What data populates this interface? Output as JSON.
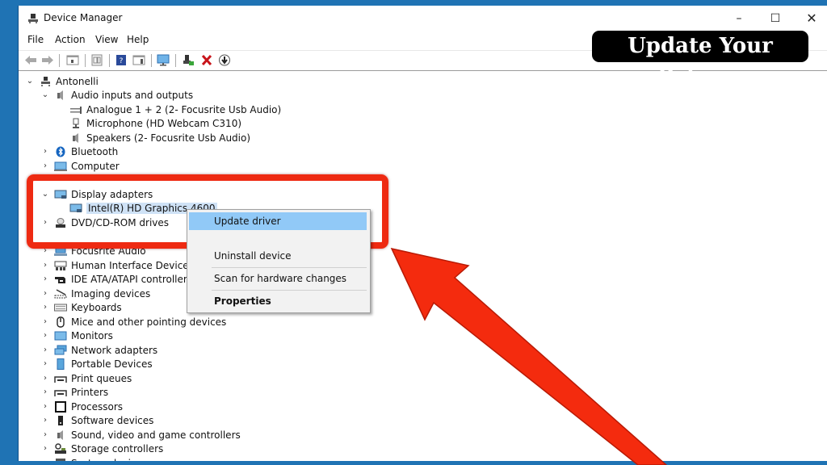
{
  "window": {
    "title": "Device Manager",
    "controls": {
      "minimize": "–",
      "maximize": "☐",
      "close": "✕"
    }
  },
  "menu": [
    "File",
    "Action",
    "View",
    "Help"
  ],
  "toolbar": {
    "icons": [
      "back-arrow-icon",
      "forward-arrow-icon",
      "show-hide-console-tree-icon",
      "properties-icon",
      "help-icon",
      "action-pane-icon",
      "scan-hardware-icon",
      "enable-device-icon",
      "uninstall-device-icon",
      "update-driver-icon"
    ]
  },
  "banner": {
    "text": "Update Your Drivers"
  },
  "tree": {
    "root": "Antonelli",
    "items": [
      {
        "label": "Audio inputs and outputs",
        "expanded": true,
        "children": [
          "Analogue 1 + 2 (2- Focusrite Usb Audio)",
          "Microphone (HD Webcam C310)",
          "Speakers (2- Focusrite Usb Audio)"
        ]
      },
      {
        "label": "Bluetooth",
        "expanded": false
      },
      {
        "label": "Computer",
        "expanded": false
      },
      {
        "label": "Display adapters",
        "expanded": true,
        "children": [
          "Intel(R) HD Graphics 4600"
        ]
      },
      {
        "label": "DVD/CD-ROM drives",
        "expanded": false
      },
      {
        "label": "Focusrite Audio",
        "expanded": false
      },
      {
        "label": "Human Interface Devices",
        "expanded": false
      },
      {
        "label": "IDE ATA/ATAPI controllers",
        "expanded": false
      },
      {
        "label": "Imaging devices",
        "expanded": false
      },
      {
        "label": "Keyboards",
        "expanded": false
      },
      {
        "label": "Mice and other pointing devices",
        "expanded": false
      },
      {
        "label": "Monitors",
        "expanded": false
      },
      {
        "label": "Network adapters",
        "expanded": false
      },
      {
        "label": "Portable Devices",
        "expanded": false
      },
      {
        "label": "Print queues",
        "expanded": false
      },
      {
        "label": "Printers",
        "expanded": false
      },
      {
        "label": "Processors",
        "expanded": false
      },
      {
        "label": "Software devices",
        "expanded": false
      },
      {
        "label": "Sound, video and game controllers",
        "expanded": false
      },
      {
        "label": "Storage controllers",
        "expanded": false
      },
      {
        "label": "System devices",
        "expanded": false
      }
    ]
  },
  "context_menu": {
    "items": [
      "Update driver",
      "Uninstall device",
      "Scan for hardware changes",
      "Properties"
    ],
    "highlighted": "Update driver"
  },
  "colors": {
    "desktop": "#1f73b4",
    "annotation_red": "#ee2a12",
    "menu_highlight": "#91c9f7"
  }
}
